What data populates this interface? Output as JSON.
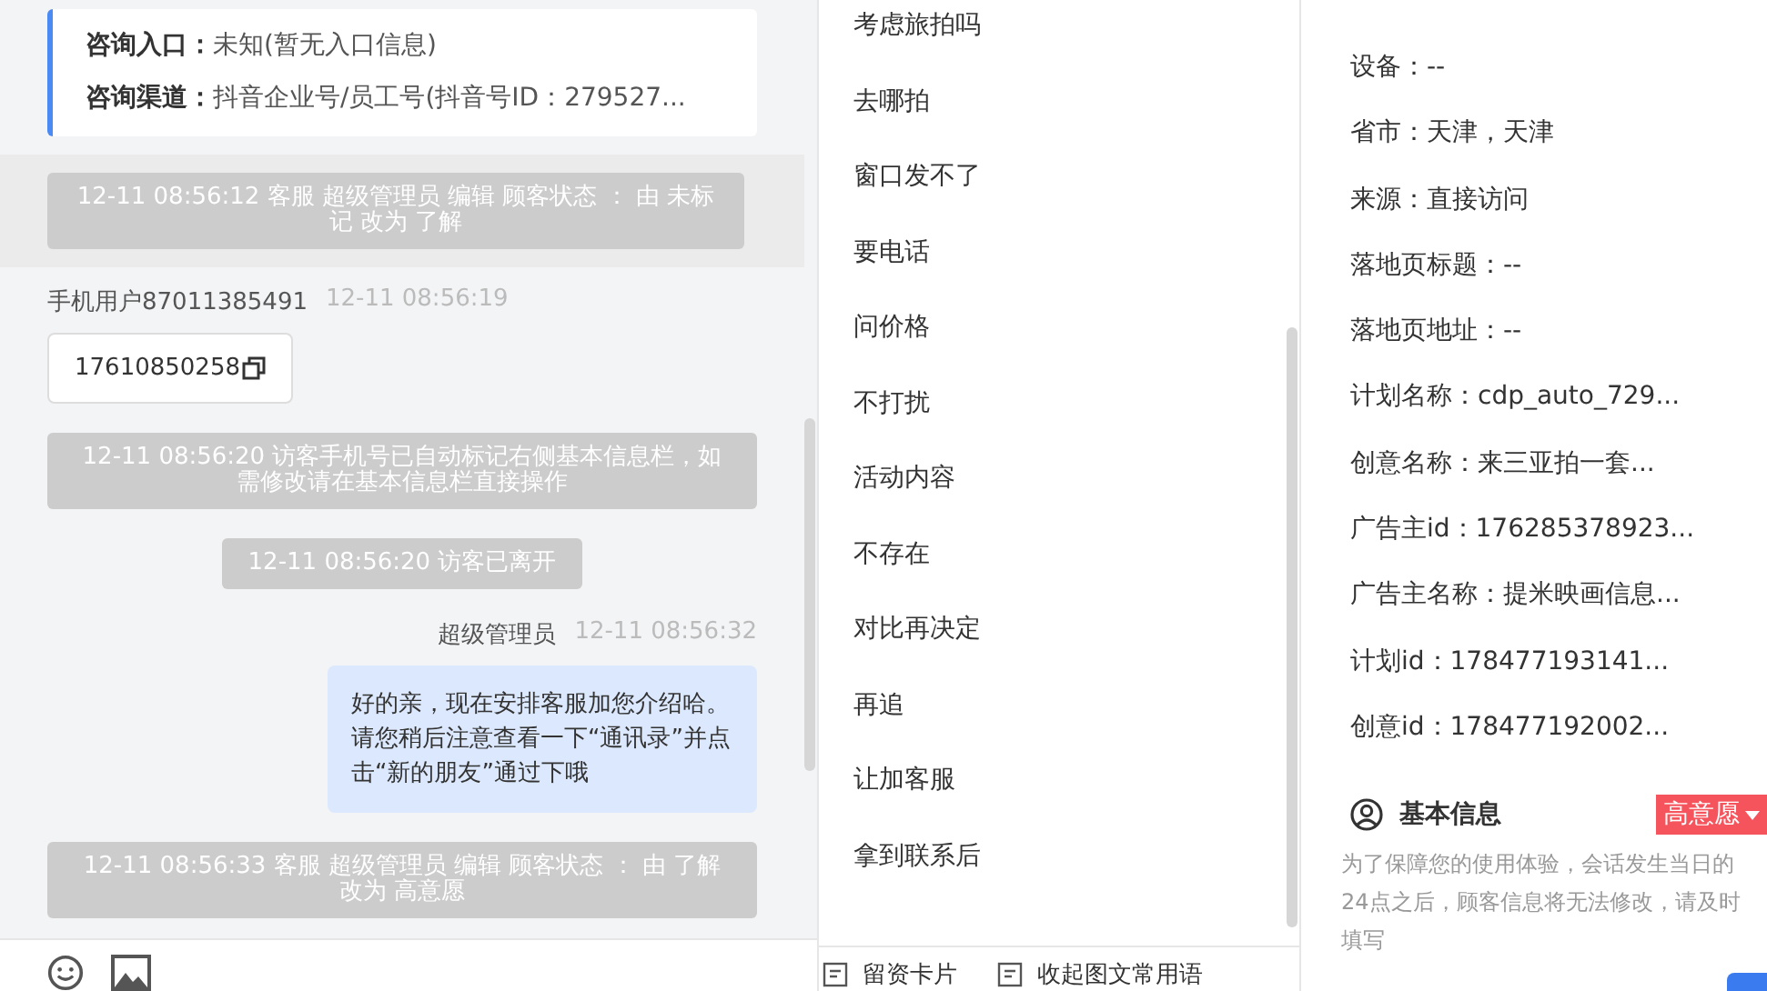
{
  "consult_card": {
    "rows": [
      {
        "label": "咨询入口：",
        "value": "未知(暂无入口信息)"
      },
      {
        "label": "咨询渠道：",
        "value": "抖音企业号/员工号(抖音号ID：279527..."
      }
    ]
  },
  "messages": [
    {
      "kind": "system",
      "highlighted": true,
      "text": "12-11 08:56:12 客服 超级管理员 编辑 顾客状态 ： 由 未标记 改为 了解"
    },
    {
      "kind": "visitor",
      "name": "手机用户87011385491",
      "time": "12-11 08:56:19",
      "text": "17610850258"
    },
    {
      "kind": "system",
      "highlighted": false,
      "text": "12-11 08:56:20 访客手机号已自动标记右侧基本信息栏，如需修改请在基本信息栏直接操作"
    },
    {
      "kind": "system",
      "highlighted": false,
      "text": "12-11 08:56:20 访客已离开"
    },
    {
      "kind": "agent",
      "name": "超级管理员",
      "time": "12-11 08:56:32",
      "text": "好的亲，现在安排客服加您介绍哈。请您稍后注意查看一下“通讯录”并点击“新的朋友”通过下哦"
    },
    {
      "kind": "system",
      "highlighted": false,
      "text": "12-11 08:56:33 客服 超级管理员 编辑 顾客状态 ： 由 了解改为 高意愿"
    }
  ],
  "phrases": [
    "考虑旅拍吗",
    "去哪拍",
    "窗口发不了",
    "要电话",
    "问价格",
    "不打扰",
    "活动内容",
    "不存在",
    "对比再决定",
    "再追",
    "让加客服",
    "拿到联系后"
  ],
  "phrase_toolbar": [
    "留资卡片",
    "收起图文常用语"
  ],
  "source_info": [
    "设备：--",
    "省市：天津，天津",
    "来源：直接访问",
    "落地页标题：--",
    "落地页地址：--",
    "计划名称：cdp_auto_729...",
    "创意名称：来三亚拍一套...",
    "广告主id：176285378923...",
    "广告主名称：提米映画信息...",
    "计划id：178477193141...",
    "创意id：178477192002..."
  ],
  "basic_info": {
    "title": "基本信息",
    "status": "高意愿",
    "note": "为了保障您的使用体验，会话发生当日的24点之后，顾客信息将无法修改，请及时填写"
  }
}
